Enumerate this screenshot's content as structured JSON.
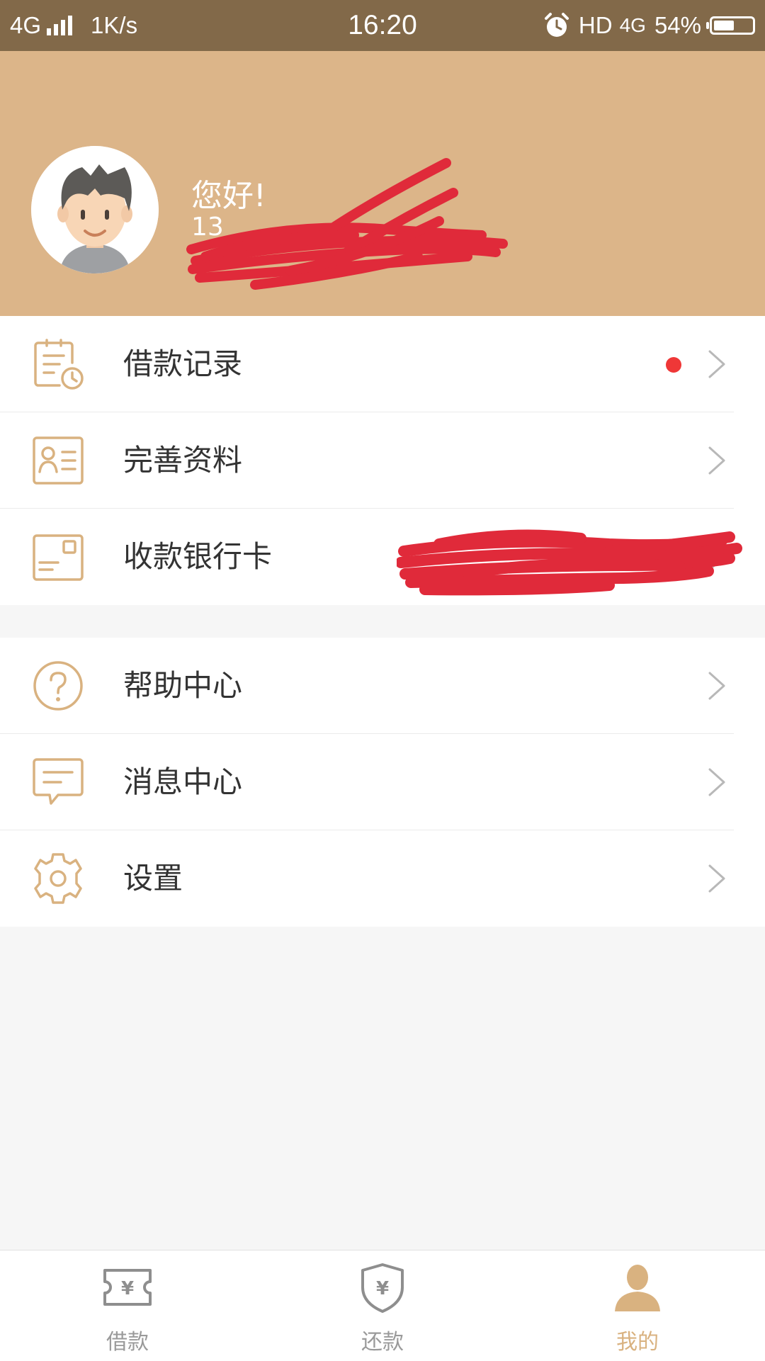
{
  "status_bar": {
    "network": "4G",
    "speed": "1K/s",
    "time": "16:20",
    "hd": "HD",
    "network_right": "4G",
    "battery": "54%"
  },
  "header": {
    "greeting": "您好!",
    "phone": "13"
  },
  "menu_group1": [
    {
      "label": "借款记录",
      "icon": "loan-record-icon",
      "has_dot": true
    },
    {
      "label": "完善资料",
      "icon": "profile-card-icon"
    },
    {
      "label": "收款银行卡",
      "icon": "bank-card-icon"
    }
  ],
  "menu_group2": [
    {
      "label": "帮助中心",
      "icon": "help-icon"
    },
    {
      "label": "消息中心",
      "icon": "message-icon"
    },
    {
      "label": "设置",
      "icon": "gear-icon"
    }
  ],
  "bottom_nav": [
    {
      "label": "借款",
      "icon": "loan-ticket-icon",
      "active": false
    },
    {
      "label": "还款",
      "icon": "repay-shield-icon",
      "active": false
    },
    {
      "label": "我的",
      "icon": "user-icon",
      "active": true
    }
  ],
  "colors": {
    "status_bar": "#826949",
    "header": "#dcb589",
    "accent": "#d9b280",
    "badge": "#ef3737"
  }
}
